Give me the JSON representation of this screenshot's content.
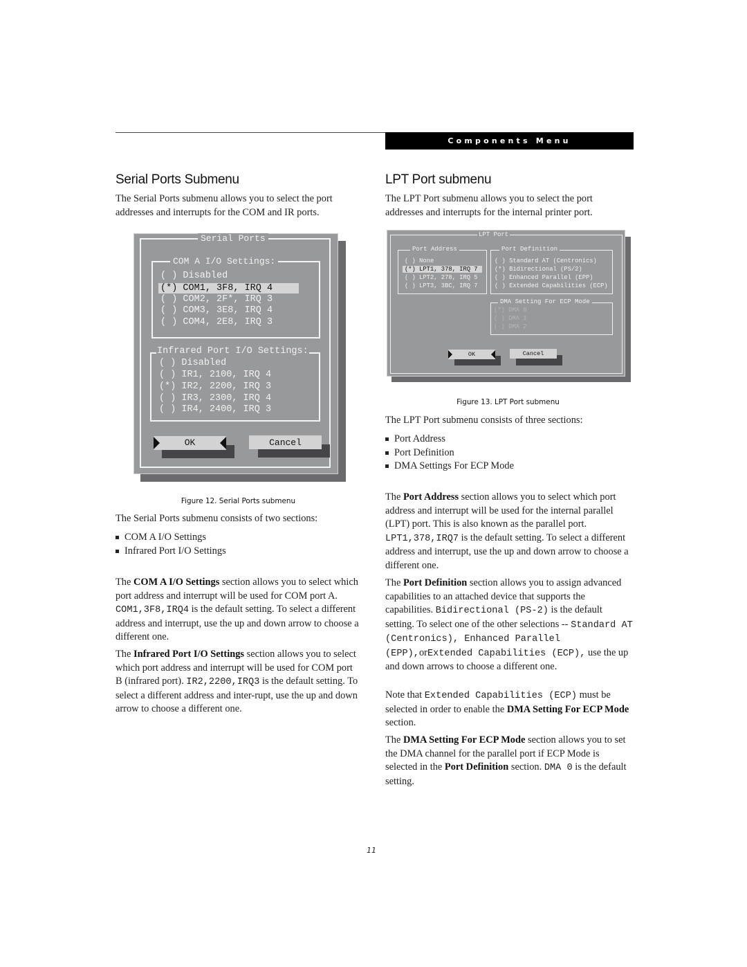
{
  "header": {
    "section_title": "Components Menu"
  },
  "left": {
    "heading": "Serial Ports Submenu",
    "intro": "The Serial Ports submenu allows you to select the port addresses and interrupts for the COM and IR ports.",
    "figure": {
      "dialog_title": "Serial Ports",
      "com_group": {
        "title": "COM A I/O Settings:",
        "options": [
          {
            "mark": "( )",
            "label": "Disabled",
            "selected": false
          },
          {
            "mark": "(*)",
            "label": "COM1, 3F8, IRQ 4",
            "selected": true
          },
          {
            "mark": "( )",
            "label": "COM2, 2F*, IRQ 3",
            "selected": false
          },
          {
            "mark": "( )",
            "label": "COM3, 3E8, IRQ 4",
            "selected": false
          },
          {
            "mark": "( )",
            "label": "COM4, 2E8, IRQ 3",
            "selected": false
          }
        ]
      },
      "ir_group": {
        "title": "Infrared Port I/O Settings:",
        "options": [
          {
            "mark": "( )",
            "label": "Disabled"
          },
          {
            "mark": "( )",
            "label": "IR1, 2100, IRQ 4"
          },
          {
            "mark": "(*)",
            "label": "IR2, 2200, IRQ 3"
          },
          {
            "mark": "( )",
            "label": "IR3, 2300, IRQ 4"
          },
          {
            "mark": "( )",
            "label": "IR4, 2400, IRQ 3"
          }
        ]
      },
      "ok_label": "OK",
      "cancel_label": "Cancel",
      "caption": "Figure 12.  Serial Ports submenu"
    },
    "sections_intro": "The Serial Ports submenu consists of two sections:",
    "bullets": [
      "COM A I/O Settings",
      "Infrared Port I/O Settings"
    ],
    "para_com": {
      "t1": "The ",
      "b1": "COM A I/O Settings",
      "t2": " section allows you to select which port address and interrupt will be used for COM port A. ",
      "code": "COM1,3F8,IRQ4",
      "t3": " is the default setting. To select a different address and interrupt, use the up and down arrow to choose a different one."
    },
    "para_ir": {
      "t1": "The ",
      "b1": "Infrared Port I/O Settings",
      "t2": " section allows you to select which port address and interrupt will be used for COM port B (infrared port). ",
      "code": "IR2,2200,IRQ3",
      "t3": " is the default setting. To select a different address and inter-rupt, use the up and down arrow to choose a different one."
    }
  },
  "right": {
    "heading": "LPT Port submenu",
    "intro": "The LPT Port submenu allows you to select the port addresses and interrupts for the internal printer port.",
    "figure": {
      "dialog_title": "LPT Port",
      "address_group": {
        "title": "Port Address",
        "options": [
          {
            "mark": "( )",
            "label": "None"
          },
          {
            "mark": "(*)",
            "label": "LPT1, 378, IRQ 7",
            "selected": true
          },
          {
            "mark": "( )",
            "label": "LPT2, 278, IRQ 5"
          },
          {
            "mark": "( )",
            "label": "LPT3, 3BC, IRQ 7"
          }
        ]
      },
      "definition_group": {
        "title": "Port Definition",
        "options": [
          {
            "mark": "( )",
            "label": "Standard AT (Centronics)"
          },
          {
            "mark": "(*)",
            "label": "Bidirectional (PS/2)"
          },
          {
            "mark": "( )",
            "label": "Enhanced Parallel (EPP)"
          },
          {
            "mark": "( )",
            "label": "Extended Capabilities (ECP)"
          }
        ]
      },
      "dma_group": {
        "title": "DMA Setting For ECP Mode",
        "disabled": true,
        "options": [
          {
            "mark": "(*)",
            "label": "DMA 0"
          },
          {
            "mark": "( )",
            "label": "DMA 1"
          },
          {
            "mark": "( )",
            "label": "DMA 2"
          }
        ]
      },
      "ok_label": "OK",
      "cancel_label": "Cancel",
      "caption": "Figure 13.  LPT Port submenu"
    },
    "sections_intro": "The LPT Port submenu consists of three sections:",
    "bullets": [
      "Port Address",
      "Port Definition",
      "DMA Settings For ECP Mode"
    ],
    "para_address": {
      "t1": "The ",
      "b1": "Port Address",
      "t2": " section allows you to select which port address and interrupt will be used for the internal parallel (LPT) port. This is also known as the parallel port. ",
      "code": "LPT1,378,IRQ7",
      "t3": " is the default setting. To select a different address and interrupt, use the up and down arrow to choose a different one."
    },
    "para_definition": {
      "t1": "The ",
      "b1": "Port Definition",
      "t2": " section allows you to assign advanced capabilities to an attached device that supports the capabilities. ",
      "code1": "Bidirectional (PS-2)",
      "t3": " is the default setting. To select one of the other selections -- ",
      "code2": "Standard AT (Centronics), Enhanced Parallel (EPP),",
      "t4": "or",
      "code3": "Extended Capabilities (ECP),",
      "t5": " use the up and down arrows to choose a different one."
    },
    "para_note": {
      "t1": "Note that ",
      "code": "Extended Capabilities (ECP)",
      "t2": " must be selected in order to enable the ",
      "b1": "DMA Setting For ECP Mode",
      "t3": " section."
    },
    "para_dma": {
      "t1": "The ",
      "b1": "DMA Setting For ECP Mode",
      "t2": " section allows you to set the DMA channel for the parallel port if ECP Mode is selected in the ",
      "b2": "Port Definition",
      "t3": " section. ",
      "code": "DMA 0",
      "t4": " is the default setting."
    }
  },
  "footer": {
    "page_number": "11"
  }
}
